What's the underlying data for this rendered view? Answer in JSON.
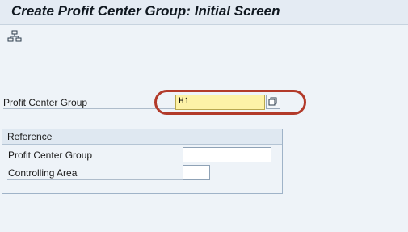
{
  "window": {
    "title": "Create Profit Center Group: Initial Screen"
  },
  "toolbar": {
    "hierarchy_icon": "hierarchy-icon"
  },
  "form": {
    "profit_center_group_label": "Profit Center Group",
    "profit_center_group_value": "H1",
    "value_help_icon": "value-help-icon"
  },
  "reference": {
    "title": "Reference",
    "profit_center_group_label": "Profit Center Group",
    "profit_center_group_value": "",
    "controlling_area_label": "Controlling Area",
    "controlling_area_value": ""
  },
  "colors": {
    "required_field": "#fdf2a7",
    "highlight_circle": "#b23a2a"
  }
}
